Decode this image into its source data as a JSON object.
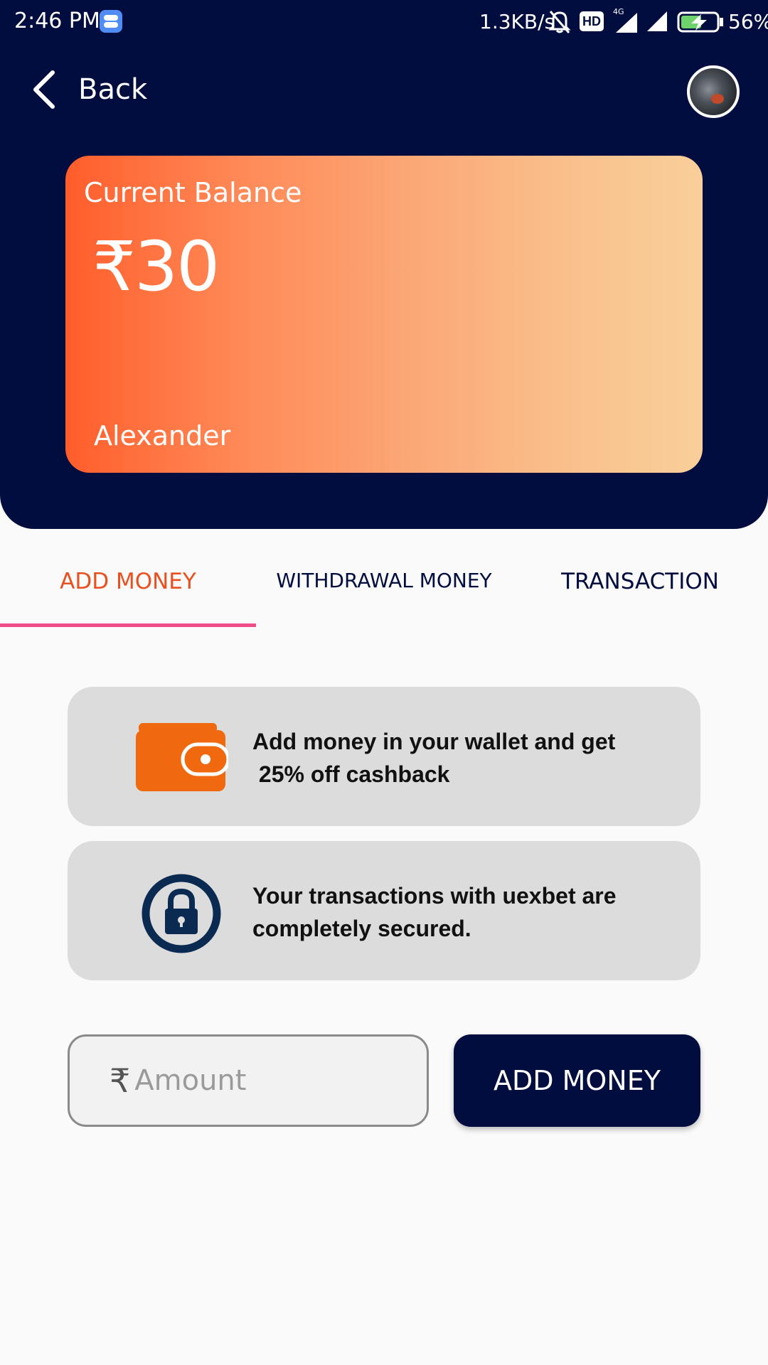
{
  "status_bar": {
    "time": "2:46 PM",
    "net_speed": "1.3KB/s",
    "hd": "HD",
    "network": "4G",
    "battery": "56%"
  },
  "nav": {
    "back_label": "Back"
  },
  "balance": {
    "label": "Current Balance",
    "amount": "₹30",
    "holder": "Alexander"
  },
  "tabs": [
    {
      "label": "ADD MONEY",
      "active": true
    },
    {
      "label": "WITHDRAWAL MONEY",
      "active": false
    },
    {
      "label": "TRANSACTION",
      "active": false
    }
  ],
  "info": [
    {
      "icon": "wallet-icon",
      "line1": "Add money in your wallet and get",
      "line2": " 25% off cashback"
    },
    {
      "icon": "lock-icon",
      "line1": "Your transactions with uexbet are",
      "line2": "completely secured."
    }
  ],
  "form": {
    "currency_symbol": "₹",
    "amount_placeholder": "Amount",
    "amount_value": "",
    "submit_label": "ADD MONEY"
  },
  "colors": {
    "header_bg": "#020d3f",
    "accent_orange": "#e8501f",
    "tab_indicator": "#ee4d8a",
    "wallet_orange": "#f0690f",
    "lock_navy": "#0a2a52"
  }
}
